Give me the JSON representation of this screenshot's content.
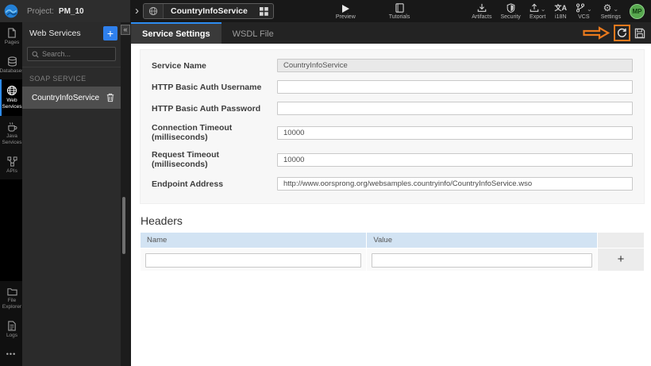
{
  "header": {
    "project_label": "Project:",
    "project_name": "PM_10",
    "breadcrumb_chevron": "›",
    "service_chip": "CountryInfoService",
    "preview_label": "Preview",
    "tutorials_label": "Tutorials",
    "artifacts_label": "Artifacts",
    "security_label": "Security",
    "export_label": "Export",
    "i18n_label": "i18N",
    "i18n_glyph": "文A",
    "vcs_label": "VCS",
    "settings_label": "Settings",
    "settings_glyph": "⚙",
    "dropdown_glyph": "⌄",
    "avatar_initials": "MP"
  },
  "rail": {
    "items": [
      {
        "label": "Pages"
      },
      {
        "label": "Databases"
      },
      {
        "label": "Web Services",
        "active": true
      },
      {
        "label": "Java Services"
      },
      {
        "label": "APIs"
      },
      {
        "label": "File Explorer"
      },
      {
        "label": "Logs"
      }
    ],
    "more_label": "•••"
  },
  "panel": {
    "title": "Web Services",
    "add_label": "+",
    "search_placeholder": "Search...",
    "section_label": "SOAP SERVICE",
    "items": [
      {
        "label": "CountryInfoService",
        "selected": true
      }
    ],
    "collapse_glyph": "«"
  },
  "tabs": [
    {
      "label": "Service Settings",
      "active": true
    },
    {
      "label": "WSDL File",
      "active": false
    }
  ],
  "form": {
    "fields": [
      {
        "label": "Service Name",
        "value": "CountryInfoService",
        "disabled": true
      },
      {
        "label": "HTTP Basic Auth Username",
        "value": ""
      },
      {
        "label": "HTTP Basic Auth Password",
        "value": ""
      },
      {
        "label": "Connection Timeout (milliseconds)",
        "value": "10000"
      },
      {
        "label": "Request Timeout (milliseconds)",
        "value": "10000"
      },
      {
        "label": "Endpoint Address",
        "value": "http://www.oorsprong.org/websamples.countryinfo/CountryInfoService.wso"
      }
    ]
  },
  "headers_section": {
    "title": "Headers",
    "columns": [
      "Name",
      "Value"
    ],
    "add_button": "+",
    "rows": [
      {
        "name": "",
        "value": ""
      }
    ]
  },
  "colors": {
    "accent_blue": "#2f80ed",
    "tab_active_border": "#2d8cf0",
    "annotation_orange": "#e8791d",
    "avatar_green": "#57a84e",
    "table_header_blue": "#d2e3f3"
  }
}
